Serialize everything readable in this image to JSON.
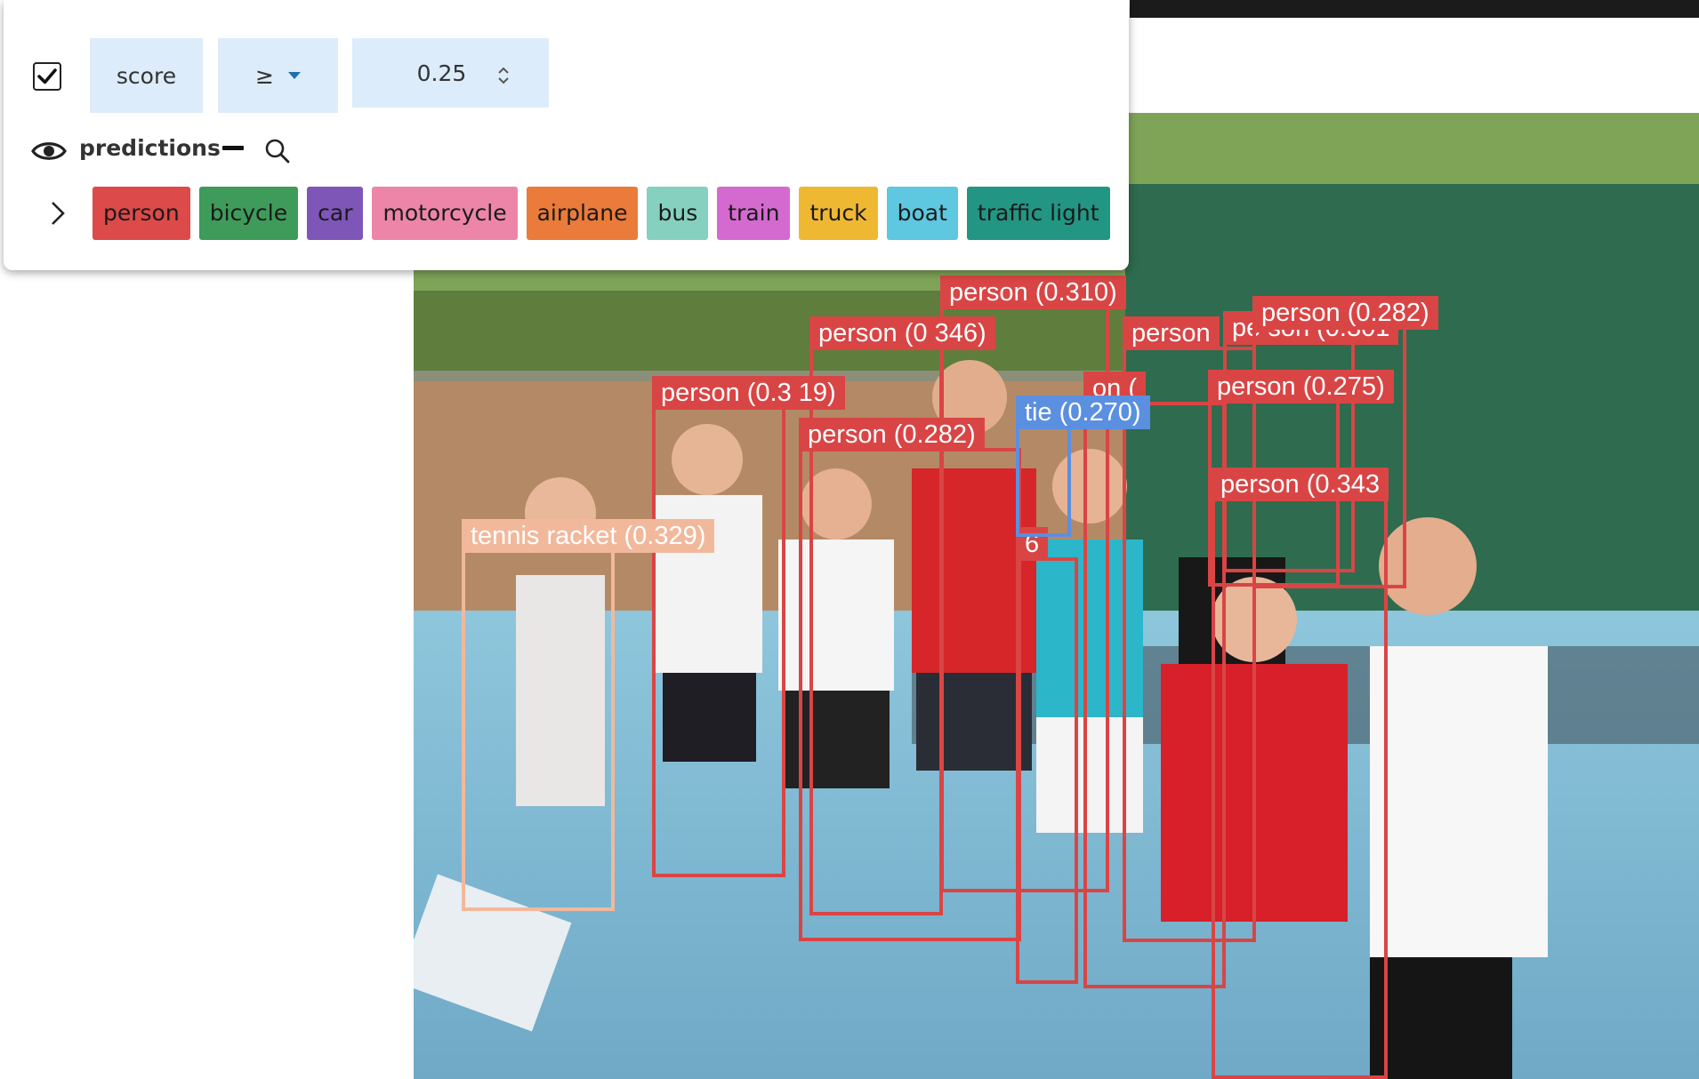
{
  "filter": {
    "enabled": true,
    "field": "score",
    "operator": "≥",
    "value": "0.25"
  },
  "predictions_label": "predictions",
  "labels": [
    {
      "name": "person",
      "color": "#dc4a4a"
    },
    {
      "name": "bicycle",
      "color": "#3e9b5a"
    },
    {
      "name": "car",
      "color": "#7e56b8"
    },
    {
      "name": "motorcycle",
      "color": "#ec85a8"
    },
    {
      "name": "airplane",
      "color": "#ea7b3a"
    },
    {
      "name": "bus",
      "color": "#86d0c0"
    },
    {
      "name": "train",
      "color": "#d46ad0"
    },
    {
      "name": "truck",
      "color": "#efb832"
    },
    {
      "name": "boat",
      "color": "#5dc8df"
    },
    {
      "name": "traffic light",
      "color": "#229683"
    }
  ],
  "detections": [
    {
      "label": "person (0.310)",
      "color": "#d94545"
    },
    {
      "label": "person (0 346)",
      "color": "#d94545"
    },
    {
      "label": "person (0.3 19)",
      "color": "#d94545"
    },
    {
      "label": "person (0.282)",
      "color": "#d94545"
    },
    {
      "label": "person",
      "color": "#d94545"
    },
    {
      "label": "pe son (0.301",
      "color": "#d94545"
    },
    {
      "label": "person (0.282)",
      "color": "#d94545"
    },
    {
      "label": "on (",
      "color": "#d94545"
    },
    {
      "label": "person (0.275)",
      "color": "#d94545"
    },
    {
      "label": "tie (0.270)",
      "color": "#5b8fe0"
    },
    {
      "label": "person (0.343",
      "color": "#d94545"
    },
    {
      "label": "tennis racket (0.329)",
      "color": "#f2b89c"
    },
    {
      "label": "6",
      "color": "#d94545"
    }
  ]
}
